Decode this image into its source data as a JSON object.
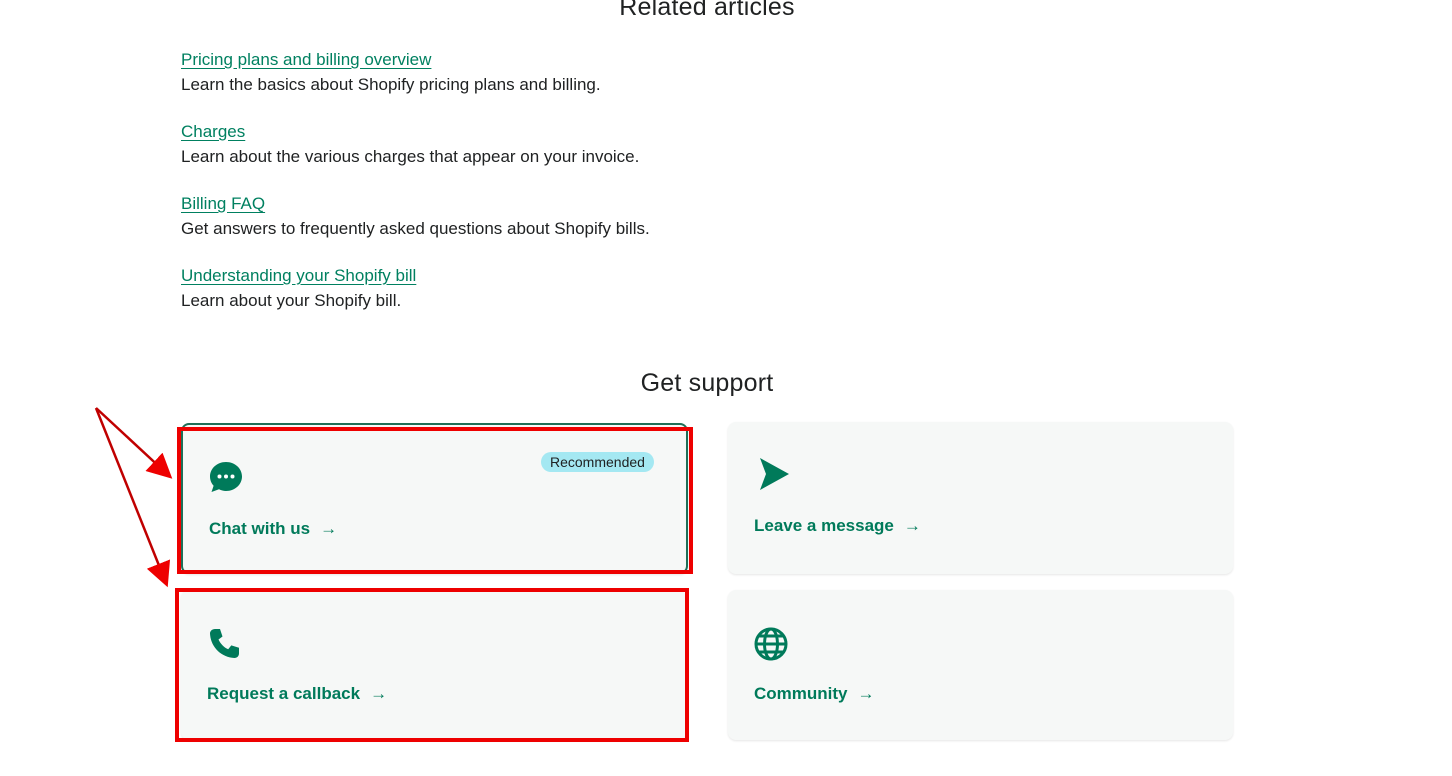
{
  "related": {
    "title": "Related articles",
    "articles": [
      {
        "link": "Pricing plans and billing overview",
        "desc": "Learn the basics about Shopify pricing plans and billing."
      },
      {
        "link": "Charges",
        "desc": "Learn about the various charges that appear on your invoice."
      },
      {
        "link": "Billing FAQ",
        "desc": "Get answers to frequently asked questions about Shopify bills."
      },
      {
        "link": "Understanding your Shopify bill",
        "desc": "Learn about your Shopify bill."
      }
    ]
  },
  "support": {
    "title": "Get support",
    "cards": {
      "chat": {
        "label": "Chat with us",
        "icon": "chat-bubble-icon",
        "badge": "Recommended"
      },
      "message": {
        "label": "Leave a message",
        "icon": "send-icon"
      },
      "callback": {
        "label": "Request a callback",
        "icon": "phone-icon"
      },
      "community": {
        "label": "Community",
        "icon": "globe-icon"
      }
    },
    "arrow_glyph": "→"
  },
  "colors": {
    "link": "#008060",
    "accent": "#007a5a",
    "badge_bg": "#a4e8f2",
    "card_bg": "#f6f8f7",
    "annotation": "#ee0000"
  }
}
